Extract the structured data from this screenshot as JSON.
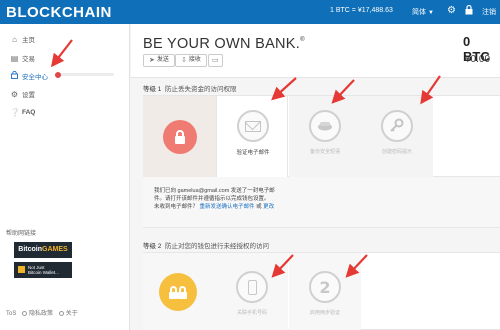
{
  "header": {
    "brand": "BLOCKCHAIN",
    "price": "1 BTC = ¥17,488.63",
    "language": "简体",
    "logout": "注销",
    "icons": [
      "gear-icon",
      "lock-icon"
    ]
  },
  "sidebar": {
    "items": [
      {
        "label": "主页",
        "icon": "home-icon"
      },
      {
        "label": "交易",
        "icon": "transactions-icon"
      },
      {
        "label": "安全中心",
        "icon": "lock-icon"
      },
      {
        "label": "设置",
        "icon": "gear-icon"
      },
      {
        "label": "FAQ",
        "icon": "question-icon"
      }
    ],
    "help_label": "帮助网链接",
    "ad1_a": "Bitcoin",
    "ad1_b": "GAMES",
    "ad2_line1": "Not Just",
    "ad2_line2": "Bitcoin Wallet...",
    "footer_tos": "ToS",
    "footer_privacy": "隐私政策",
    "footer_about": "关于"
  },
  "main": {
    "slogan": "BE YOUR OWN BANK.",
    "slogan_mark": "®",
    "send_label": "发送",
    "receive_label": "接收",
    "balance_btc": "0 BTC",
    "balance_cny": "¥0.00"
  },
  "level1": {
    "label": "等级 1",
    "title": "防止丢失资金的访问权限",
    "steps": [
      "验证电子邮件",
      "备份安全短语",
      "创建密码提示"
    ],
    "msg_line1": "我们已向 gamelua@gmail.com 发送了一封电子邮",
    "msg_line2": "件。请打开该邮件并遵循指示以完成钱包设置。",
    "msg_line3_prefix": "未收到电子邮件？",
    "msg_resend": "重新发送确认电子邮件",
    "msg_or": "或",
    "msg_change": "更改"
  },
  "level2": {
    "label": "等级 2",
    "title": "防止对您的钱包进行未经授权的访问",
    "steps": [
      "关联手机号码",
      "启用两步验证"
    ]
  }
}
